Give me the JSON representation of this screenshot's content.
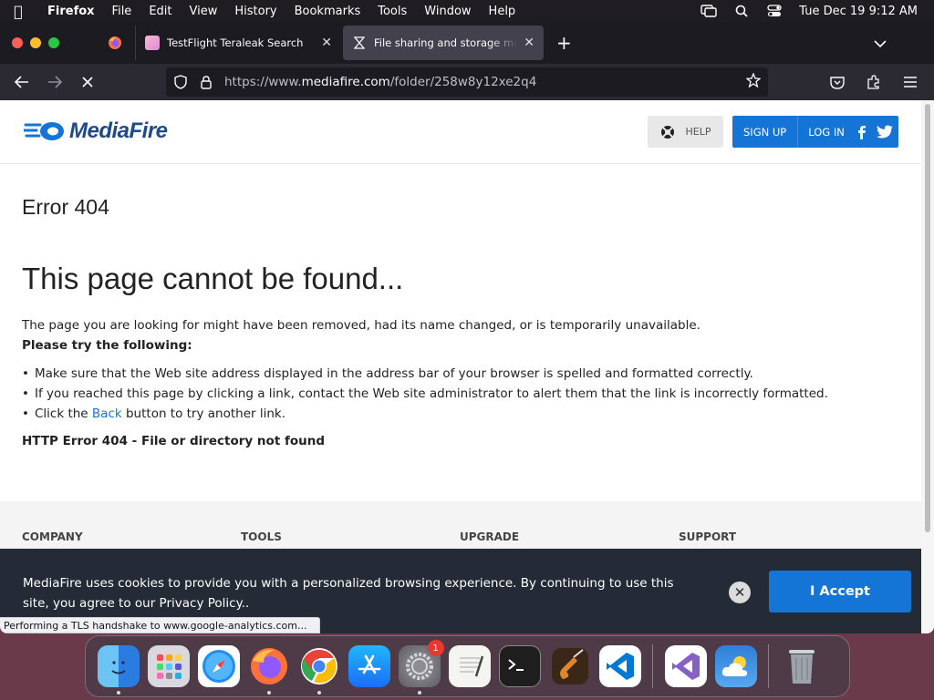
{
  "menubar": {
    "app": "Firefox",
    "items": [
      "File",
      "Edit",
      "View",
      "History",
      "Bookmarks",
      "Tools",
      "Window",
      "Help"
    ],
    "clock": "Tue Dec 19  9:12 AM"
  },
  "browser": {
    "tabs": [
      {
        "label": "TestFlight Teraleak Search"
      },
      {
        "label": "File sharing and storage made simple"
      }
    ],
    "url_prefix": "https://www.",
    "url_domain": "mediafire.com",
    "url_path": "/folder/258w8y12xe2q4",
    "status": "Performing a TLS handshake to www.google-analytics.com..."
  },
  "site": {
    "logo": "MediaFire",
    "help": "HELP",
    "signup": "SIGN UP",
    "login": "LOG IN"
  },
  "error": {
    "code": "Error 404",
    "title": "This page cannot be found...",
    "desc": "The page you are looking for might have been removed, had its name changed, or is temporarily unavailable.",
    "try": "Please try the following:",
    "items": [
      "Make sure that the Web site address displayed in the address bar of your browser is spelled and formatted correctly.",
      "If you reached this page by clicking a link, contact the Web site administrator to alert them that the link is incorrectly formatted."
    ],
    "back_pre": "Click the ",
    "back_link": "Back",
    "back_post": " button to try another link.",
    "http": "HTTP Error 404 - File or directory not found"
  },
  "footer": {
    "columns": [
      "COMPANY",
      "TOOLS",
      "UPGRADE",
      "SUPPORT"
    ]
  },
  "cookie": {
    "text": "MediaFire uses cookies to provide you with a personalized browsing experience. By continuing to use this site, you agree to our Privacy Policy..",
    "accept": "I Accept"
  },
  "dock": {
    "settings_badge": "1"
  }
}
